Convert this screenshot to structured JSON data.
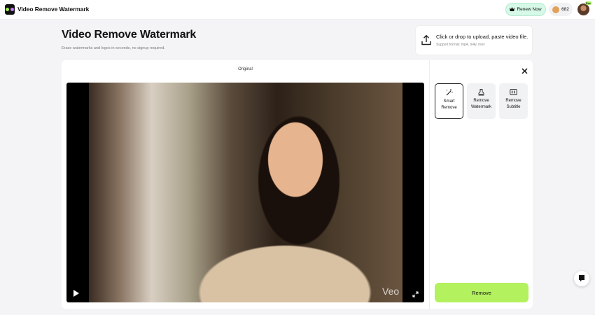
{
  "header": {
    "app_name": "Video Remove Watermark",
    "renew_label": "Renew Now",
    "credits": "682",
    "pro_badge": "Pro"
  },
  "page": {
    "title": "Video Remove Watermark",
    "subtitle": "Erase watermarks and logos in seconds, no signup required."
  },
  "upload": {
    "title": "Click or drop to upload, paste video file.",
    "formats": "Support format: mp4, m4v, mov"
  },
  "preview": {
    "label": "Original",
    "watermark_text": "Veo"
  },
  "tools": [
    {
      "label": "Smart Remove",
      "icon": "magic-wand-icon",
      "active": true
    },
    {
      "label": "Remove Watermark",
      "icon": "stamp-icon",
      "active": false
    },
    {
      "label": "Remove Subtitle",
      "icon": "cc-icon",
      "active": false
    }
  ],
  "actions": {
    "remove_label": "Remove"
  },
  "colors": {
    "accent": "#b3f15e",
    "renew_bg": "#d6f9e8"
  }
}
